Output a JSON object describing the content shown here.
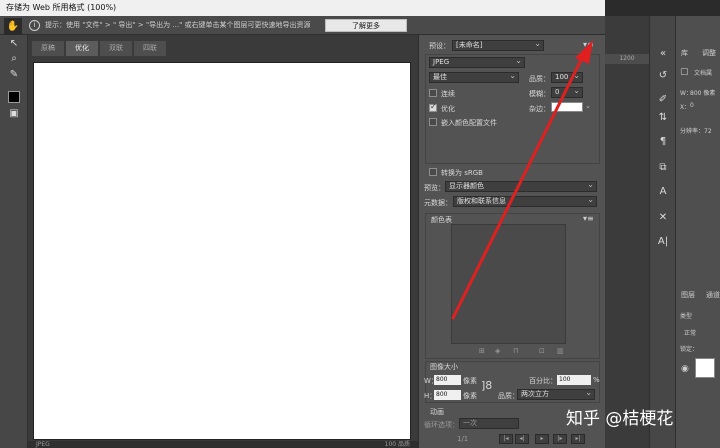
{
  "window": {
    "title": "存储为 Web 所用格式 (100%)"
  },
  "toolbar": {
    "info_icon": "info-circle-icon",
    "hint": "提示：使用 \"文件\" > \" 导出\" > \"导出为 ...\" 或右键单击某个图层可更快速地导出资源",
    "learn_more": "了解更多"
  },
  "tabs": [
    {
      "label": "原稿"
    },
    {
      "label": "优化"
    },
    {
      "label": "双联"
    },
    {
      "label": "四联"
    }
  ],
  "settings": {
    "preset_label": "预设：",
    "preset_value": "[未命名]",
    "format_value": "JPEG",
    "quality_preset_value": "最佳",
    "quality_label": "品质：",
    "quality_value": "100",
    "progressive_label": "连续",
    "blur_label": "模糊：",
    "blur_value": "0",
    "optimized_label": "优化",
    "matte_label": "杂边：",
    "embed_profile_label": "嵌入颜色配置文件",
    "convert_srgb_label": "转换为 sRGB",
    "preview_label": "预览：",
    "preview_value": "显示器颜色",
    "metadata_label": "元数据：",
    "metadata_value": "版权和联系信息",
    "color_table_label": "颜色表",
    "image_size_label": "图像大小",
    "width_label": "W：",
    "width_value": "800",
    "height_label": "H：",
    "height_value": "800",
    "px_unit_w": "像素",
    "px_unit_h": "像素",
    "percent_label": "百分比：",
    "percent_value": "100",
    "percent_sign": "%",
    "resample_label": "品质：",
    "resample_value": "两次立方",
    "animation_label": "动画",
    "loop_label": "循环选项：",
    "loop_value": "一次",
    "frame_counter": "1/1"
  },
  "preview_status": {
    "left": "JPEG",
    "right": "100 品质"
  },
  "ps_panel": {
    "ruler_value": "1200",
    "tab_library": "库",
    "tab_adjust": "调整",
    "doc_label": "文档属",
    "w_label": "W：",
    "w_value": "800 像素",
    "x_label": "X：",
    "x_value": "0",
    "resolution": "分辨率：72",
    "layers_tab": "图层",
    "channels_tab": "通道",
    "kind_label": "类型",
    "blend_label": "正常",
    "lock_label": "锁定："
  },
  "watermark": "知乎 @桔梗花",
  "colors": {
    "annotation_arrow": "#e02020"
  }
}
